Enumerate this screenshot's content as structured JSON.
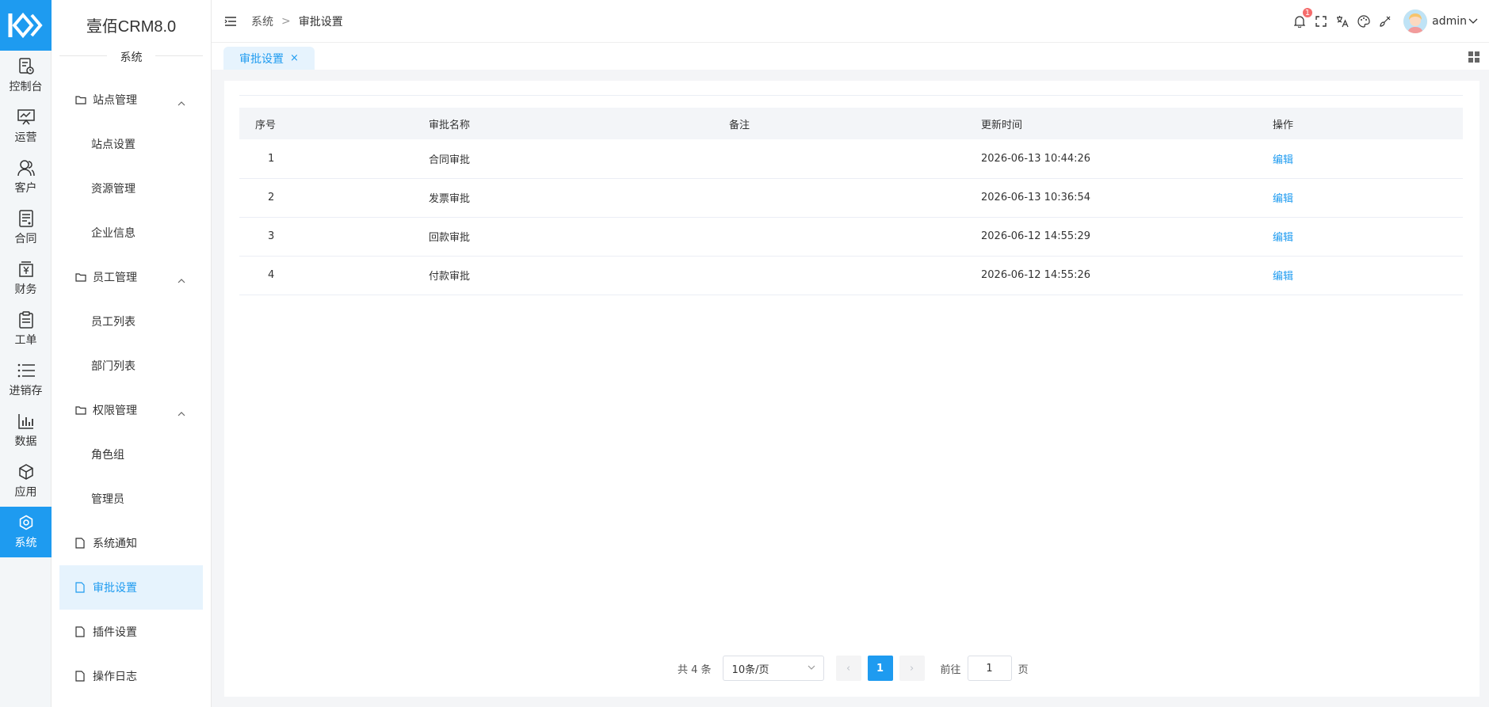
{
  "app": {
    "name": "壹佰CRM8.0",
    "section": "系统"
  },
  "rail": [
    {
      "label": "控制台",
      "icon": "dashboard-icon"
    },
    {
      "label": "运营",
      "icon": "presentation-icon"
    },
    {
      "label": "客户",
      "icon": "users-icon"
    },
    {
      "label": "合同",
      "icon": "contract-icon"
    },
    {
      "label": "财务",
      "icon": "yen-icon"
    },
    {
      "label": "工单",
      "icon": "clipboard-icon"
    },
    {
      "label": "进销存",
      "icon": "list-icon"
    },
    {
      "label": "数据",
      "icon": "bar-chart-icon"
    },
    {
      "label": "应用",
      "icon": "cube-icon"
    },
    {
      "label": "系统",
      "icon": "settings-icon",
      "active": true
    }
  ],
  "menu": {
    "g1": {
      "label": "站点管理",
      "items": [
        "站点设置",
        "资源管理",
        "企业信息"
      ]
    },
    "g2": {
      "label": "员工管理",
      "items": [
        "员工列表",
        "部门列表"
      ]
    },
    "g3": {
      "label": "权限管理",
      "items": [
        "角色组",
        "管理员"
      ]
    },
    "leaves": [
      "系统通知",
      "审批设置",
      "插件设置",
      "操作日志"
    ]
  },
  "header": {
    "breadcrumb": [
      "系统",
      "审批设置"
    ],
    "separator": ">",
    "notification_count": "1",
    "username": "admin"
  },
  "tab": {
    "label": "审批设置",
    "close": "×"
  },
  "table": {
    "columns": [
      "序号",
      "审批名称",
      "备注",
      "更新时间",
      "操作"
    ],
    "rows": [
      {
        "idx": "1",
        "name": "合同审批",
        "note": "",
        "time": "2026-06-13 10:44:26",
        "op": "编辑"
      },
      {
        "idx": "2",
        "name": "发票审批",
        "note": "",
        "time": "2026-06-13 10:36:54",
        "op": "编辑"
      },
      {
        "idx": "3",
        "name": "回款审批",
        "note": "",
        "time": "2026-06-12 14:55:29",
        "op": "编辑"
      },
      {
        "idx": "4",
        "name": "付款审批",
        "note": "",
        "time": "2026-06-12 14:55:26",
        "op": "编辑"
      }
    ]
  },
  "pagination": {
    "total": "共 4 条",
    "page_size": "10条/页",
    "prev": "‹",
    "current": "1",
    "next": "›",
    "goto_label": "前往",
    "goto_value": "1",
    "page_unit": "页"
  },
  "colors": {
    "accent": "#1e9bf0",
    "active_bg": "#e6f3fd",
    "badge": "#f56c6c"
  }
}
